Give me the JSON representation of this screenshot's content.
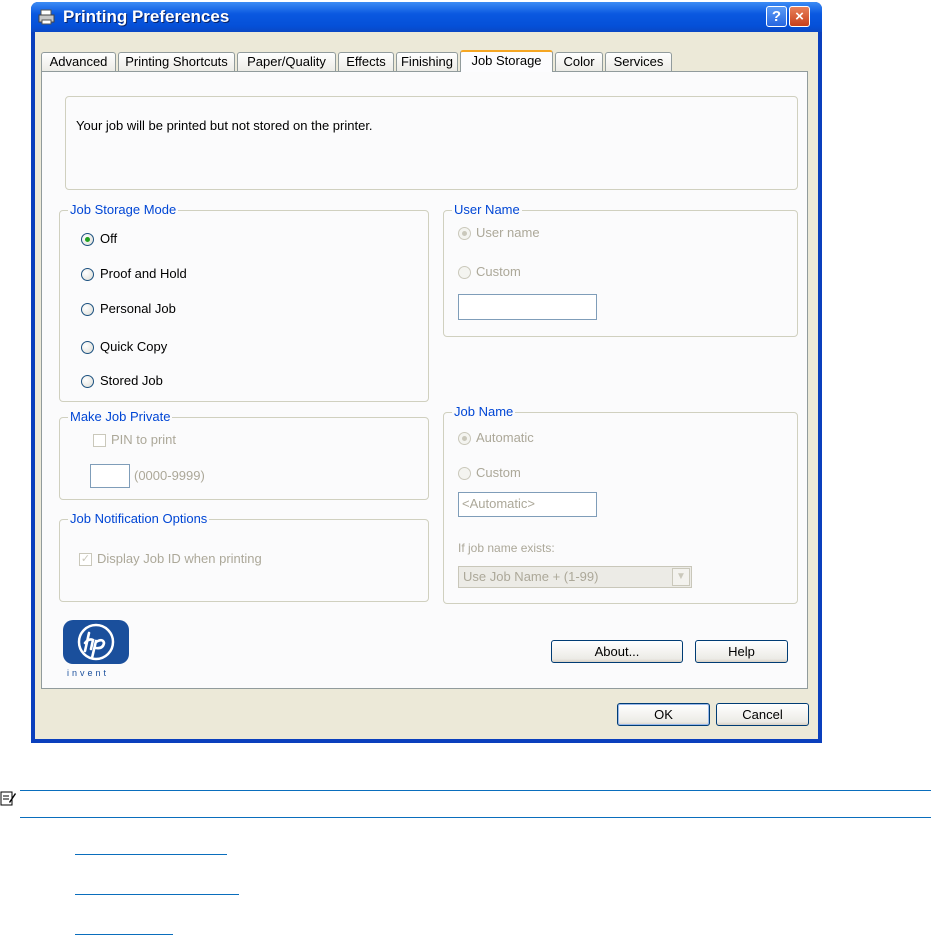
{
  "window": {
    "title": "Printing Preferences",
    "help_button": "?",
    "close_button": "×"
  },
  "tabs": [
    {
      "label": "Advanced"
    },
    {
      "label": "Printing Shortcuts"
    },
    {
      "label": "Paper/Quality"
    },
    {
      "label": "Effects"
    },
    {
      "label": "Finishing"
    },
    {
      "label": "Job Storage",
      "active": true
    },
    {
      "label": "Color"
    },
    {
      "label": "Services"
    }
  ],
  "message": "Your job will be printed but not stored on the printer.",
  "job_storage_mode": {
    "legend": "Job Storage Mode",
    "options": [
      {
        "label": "Off",
        "checked": true
      },
      {
        "label": "Proof and Hold",
        "checked": false
      },
      {
        "label": "Personal Job",
        "checked": false
      },
      {
        "label": "Quick Copy",
        "checked": false
      },
      {
        "label": "Stored Job",
        "checked": false
      }
    ]
  },
  "make_job_private": {
    "legend": "Make Job Private",
    "pin_label": "PIN to print",
    "pin_checked": false,
    "pin_value": "",
    "range_label": "(0000-9999)"
  },
  "job_notification": {
    "legend": "Job Notification Options",
    "display_label": "Display Job ID when printing",
    "display_checked": true
  },
  "user_name": {
    "legend": "User Name",
    "option_user": "User name",
    "option_custom": "Custom",
    "custom_value": ""
  },
  "job_name": {
    "legend": "Job Name",
    "option_auto": "Automatic",
    "option_custom": "Custom",
    "custom_value": "<Automatic>",
    "exists_label": "If job name exists:",
    "exists_selected": "Use Job Name + (1-99)"
  },
  "buttons": {
    "about": "About...",
    "help": "Help",
    "ok": "OK",
    "cancel": "Cancel"
  },
  "logo": {
    "text": "invent"
  },
  "icons": {
    "title": "printer-icon",
    "note": "note-icon"
  }
}
